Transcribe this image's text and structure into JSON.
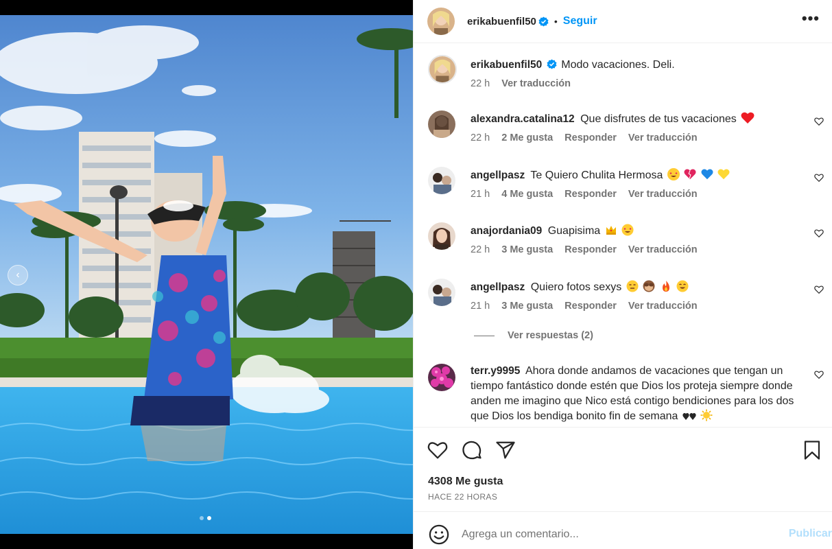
{
  "post": {
    "author": "erikabuenfil50",
    "follow_label": "Seguir",
    "separator": "•",
    "more_label": "•••",
    "caption": "Modo vacaciones. Deli.",
    "caption_time": "22 h",
    "caption_translate": "Ver traducción"
  },
  "comments": [
    {
      "user": "alexandra.catalina12",
      "text": "Que disfrutes de tus vacaciones",
      "time": "22 h",
      "likes": "2 Me gusta",
      "reply": "Responder",
      "translate": "Ver traducción"
    },
    {
      "user": "angellpasz",
      "text": "Te Quiero Chulita Hermosa",
      "time": "21 h",
      "likes": "4 Me gusta",
      "reply": "Responder",
      "translate": "Ver traducción"
    },
    {
      "user": "anajordania09",
      "text": "Guapisima",
      "time": "22 h",
      "likes": "3 Me gusta",
      "reply": "Responder",
      "translate": "Ver traducción"
    },
    {
      "user": "angellpasz",
      "text": "Quiero fotos sexys",
      "time": "21 h",
      "likes": "3 Me gusta",
      "reply": "Responder",
      "translate": "Ver traducción"
    },
    {
      "user": "terr.y9995",
      "text": "Ahora donde andamos de vacaciones que tengan un tiempo fantástico donde estén que Dios los proteja siempre donde anden me imagino que Nico está contigo bendiciones para los dos que Dios los bendiga bonito fin de semana"
    }
  ],
  "view_replies": "Ver respuestas (2)",
  "likes_count": "4308 Me gusta",
  "posted_when": "HACE 22 HORAS",
  "add_comment": {
    "placeholder": "Agrega un comentario...",
    "publish_label": "Publicar"
  },
  "carousel": {
    "slide_count": 2,
    "active_slide": 2,
    "prev_label": "‹"
  },
  "colors": {
    "accent": "#0095f6",
    "verified": "#0095f6",
    "text": "#262626",
    "secondary": "#737373",
    "heart_red": "#ed1c24"
  }
}
